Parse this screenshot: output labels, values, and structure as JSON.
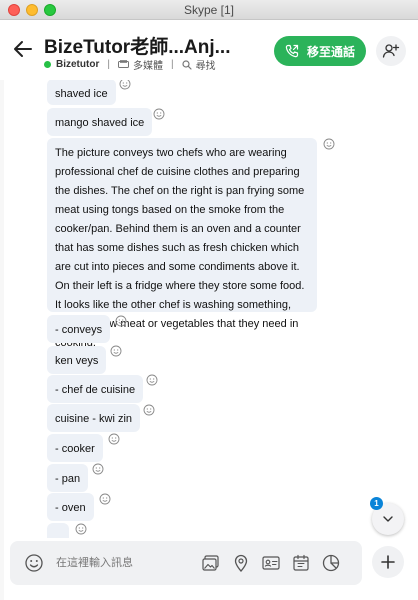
{
  "window": {
    "title": "Skype [1]"
  },
  "header": {
    "contact_name": "BizeTutor老師...Anj...",
    "sub_name": "Bizetutor",
    "separator": "|",
    "media_label": "多媒體",
    "search_label": "尋找",
    "call_button_label": "移至通話"
  },
  "messages": [
    {
      "text": "shaved ice"
    },
    {
      "text": "mango shaved ice"
    },
    {
      "text": "The picture conveys two chefs who are wearing professional chef de cuisine clothes and  preparing the dishes. The chef on the right is pan frying some meat using tongs based on the smoke from the cooker/pan. Behind them is an oven and a counter that has some dishes such as fresh chicken which are cut into pieces and some condiments above it. On their left is a fridge where they store some food. It looks like the other chef is washing something, could be raw meat or vegetables that they need in cooking."
    },
    {
      "text": "- conveys"
    },
    {
      "text": "ken veys"
    },
    {
      "text": "- chef de cuisine"
    },
    {
      "text": "cuisine - kwi zin"
    },
    {
      "text": "- cooker"
    },
    {
      "text": "- pan"
    },
    {
      "text": "- oven"
    },
    {
      "text": ""
    }
  ],
  "scroll": {
    "unread_count": "1"
  },
  "composer": {
    "placeholder": "在這裡輸入訊息"
  },
  "colors": {
    "accent_green": "#2bb35a",
    "bubble_bg": "#edf1f7",
    "badge_blue": "#0a84d8",
    "status_online": "#27c046"
  },
  "icons": {
    "back": "arrow-left-icon",
    "call": "phone-icon",
    "add_person": "add-person-icon",
    "reaction": "smiley-icon",
    "emoji": "emoji-icon",
    "gallery": "gallery-icon",
    "location": "location-pin-icon",
    "contact_card": "contact-card-icon",
    "schedule": "calendar-icon",
    "poll": "poll-icon",
    "plus": "plus-icon",
    "scroll_down": "chevron-down-icon"
  }
}
